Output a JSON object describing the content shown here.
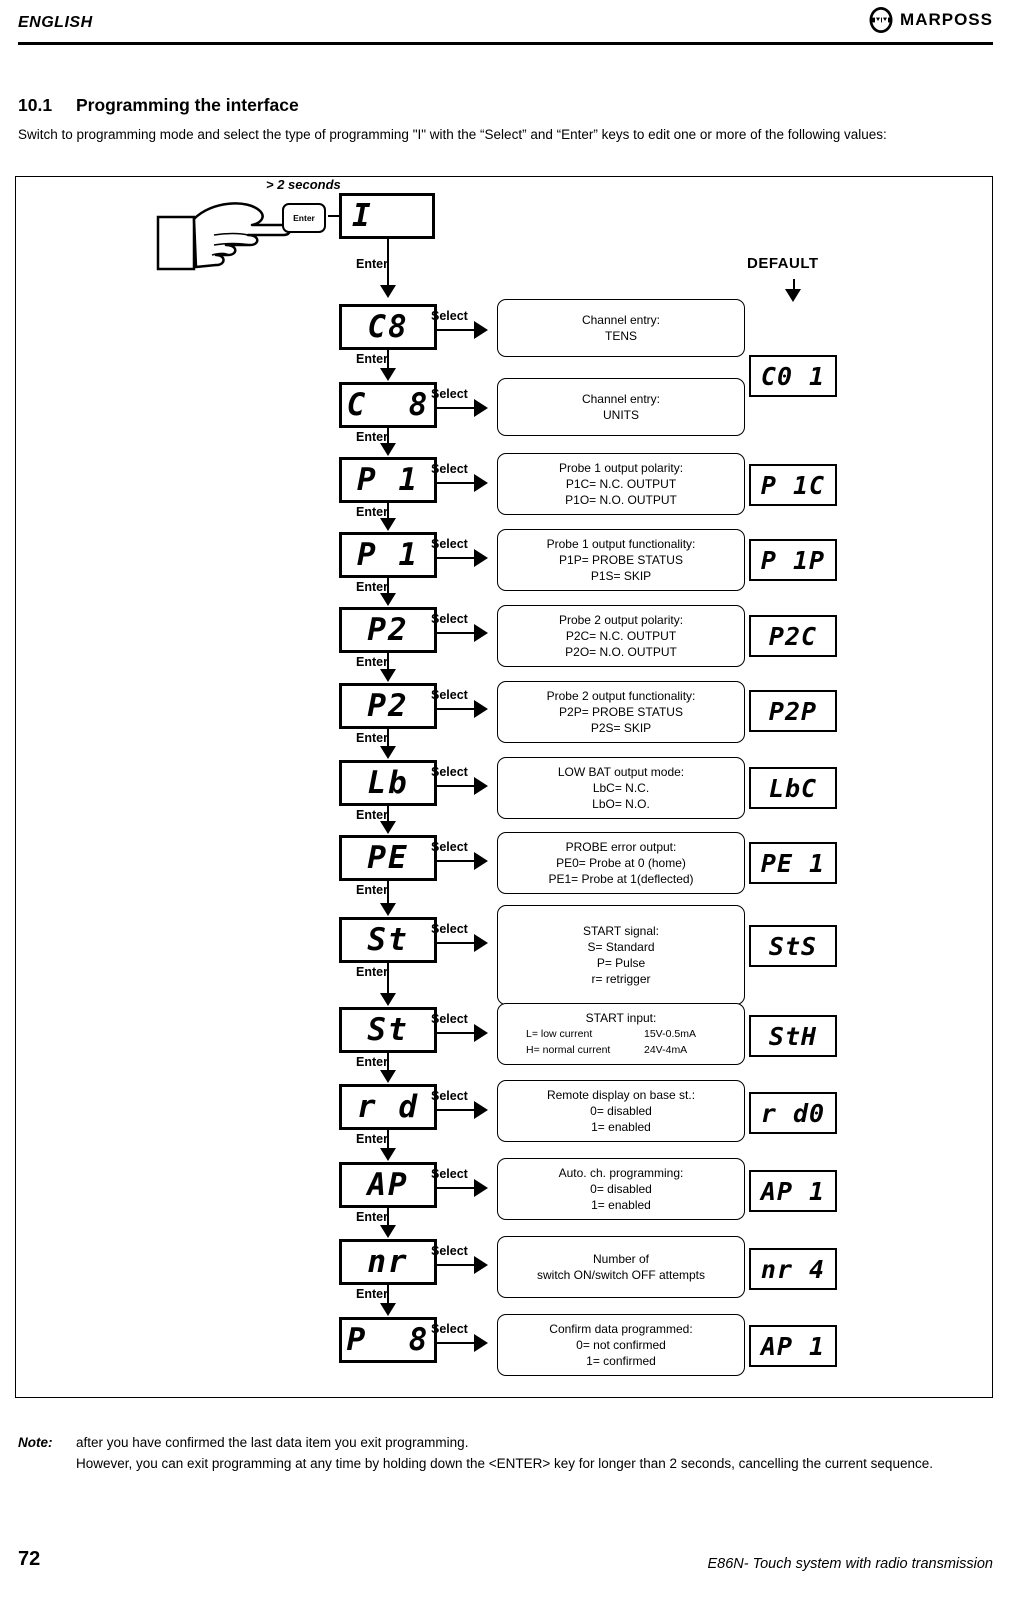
{
  "header": {
    "language": "ENGLISH",
    "brand": "MARPOSS"
  },
  "section": {
    "number": "10.1",
    "title": "Programming the interface",
    "intro": "Switch to programming mode and select the type of programming \"I\" with the “Select” and “Enter” keys to edit one or more of the following values:"
  },
  "diagram": {
    "hold_hint": "> 2 seconds",
    "enter_key_label": "Enter",
    "enter_label": "Enter",
    "select_label": "Select",
    "default_label": "DEFAULT",
    "start_display": "I",
    "steps": [
      {
        "code": "C8",
        "desc_lines": [
          "Channel entry:",
          "TENS"
        ],
        "default": "C0 1"
      },
      {
        "code": "C  8",
        "desc_lines": [
          "Channel entry:",
          "UNITS"
        ],
        "default": ""
      },
      {
        "code": "P 1",
        "desc_lines": [
          "Probe 1 output polarity:",
          "P1C= N.C. OUTPUT",
          "P1O= N.O. OUTPUT"
        ],
        "default": "P 1C"
      },
      {
        "code": "P 1",
        "desc_lines": [
          "Probe 1 output functionality:",
          "P1P= PROBE STATUS",
          "P1S= SKIP"
        ],
        "default": "P 1P"
      },
      {
        "code": "P2",
        "desc_lines": [
          "Probe 2 output polarity:",
          "P2C= N.C. OUTPUT",
          "P2O= N.O. OUTPUT"
        ],
        "default": "P2C"
      },
      {
        "code": "P2",
        "desc_lines": [
          "Probe 2 output functionality:",
          "P2P= PROBE STATUS",
          "P2S= SKIP"
        ],
        "default": "P2P"
      },
      {
        "code": "Lb",
        "desc_lines": [
          "LOW BAT output mode:",
          "LbC=  N.C.",
          "LbO= N.O."
        ],
        "default": "LbC"
      },
      {
        "code": "PE",
        "desc_lines": [
          "PROBE error output:",
          "PE0= Probe at 0 (home)",
          "PE1= Probe at 1(deflected)"
        ],
        "default": "PE 1"
      },
      {
        "code": "St",
        "desc_lines": [
          "START signal:",
          "S= Standard",
          "P= Pulse",
          "r= retrigger"
        ],
        "default": "StS"
      },
      {
        "code": "St",
        "desc_title": "START input:",
        "desc_rows": [
          {
            "label": "L= low current",
            "value": "15V-0.5mA"
          },
          {
            "label": "H= normal current",
            "value": "24V-4mA"
          }
        ],
        "default": "StH"
      },
      {
        "code": "r d",
        "desc_lines": [
          "Remote display on base st.:",
          "0= disabled",
          "1= enabled"
        ],
        "default": "r d0"
      },
      {
        "code": "AP",
        "desc_lines": [
          "Auto. ch. programming:",
          "0= disabled",
          "1= enabled"
        ],
        "default": "AP 1"
      },
      {
        "code": "nr",
        "desc_lines": [
          "Number of",
          "switch ON/switch OFF  attempts"
        ],
        "default": "nr 4"
      },
      {
        "code": "P  8",
        "desc_lines": [
          "Confirm data programmed:",
          "0= not confirmed",
          "1= confirmed"
        ],
        "default": "AP 1"
      }
    ]
  },
  "note": {
    "tag": "Note:",
    "line1": "after you have confirmed the last data item you exit programming.",
    "line2": "However, you can exit programming at any time by holding down the <ENTER> key for longer than 2 seconds, cancelling the current sequence."
  },
  "footer": {
    "page_number": "72",
    "doc_title": "E86N- Touch system with radio transmission"
  }
}
